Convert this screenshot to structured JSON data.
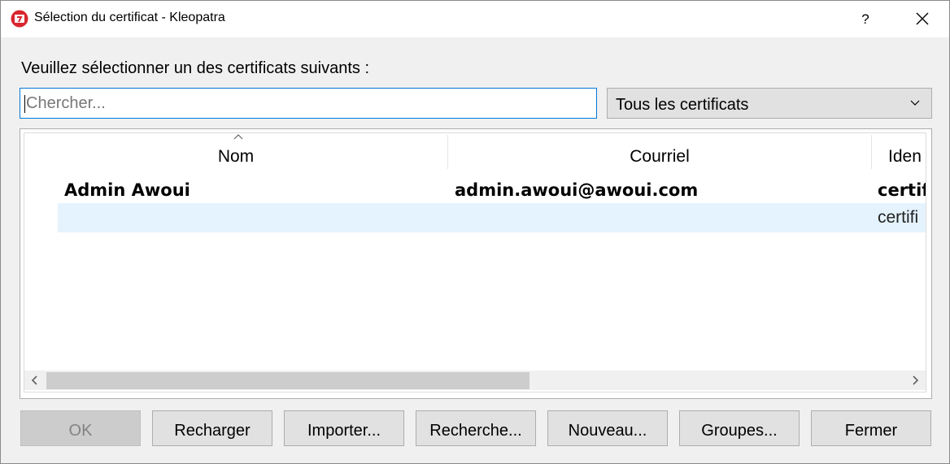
{
  "window": {
    "title": "Sélection du certificat - Kleopatra",
    "help_label": "?"
  },
  "prompt": "Veuillez sélectionner un des certificats suivants :",
  "search": {
    "placeholder": "Chercher...",
    "value": ""
  },
  "filter": {
    "selected": "Tous les certificats"
  },
  "table": {
    "columns": [
      "Nom",
      "Courriel",
      "Iden"
    ],
    "sort_column": "Nom",
    "rows": [
      {
        "name": "Admin Awoui",
        "email": "admin.awoui@awoui.com",
        "id": "certif",
        "bold": true
      },
      {
        "name": "",
        "email": "",
        "id": "certifi",
        "bold": false,
        "highlighted": true
      }
    ]
  },
  "buttons": {
    "ok": "OK",
    "reload": "Recharger",
    "import": "Importer...",
    "search": "Recherche...",
    "new": "Nouveau...",
    "groups": "Groupes...",
    "close": "Fermer"
  },
  "colors": {
    "focus_border": "#0078d7",
    "row_highlight": "#e5f3ff",
    "app_icon": "#d9262d"
  }
}
